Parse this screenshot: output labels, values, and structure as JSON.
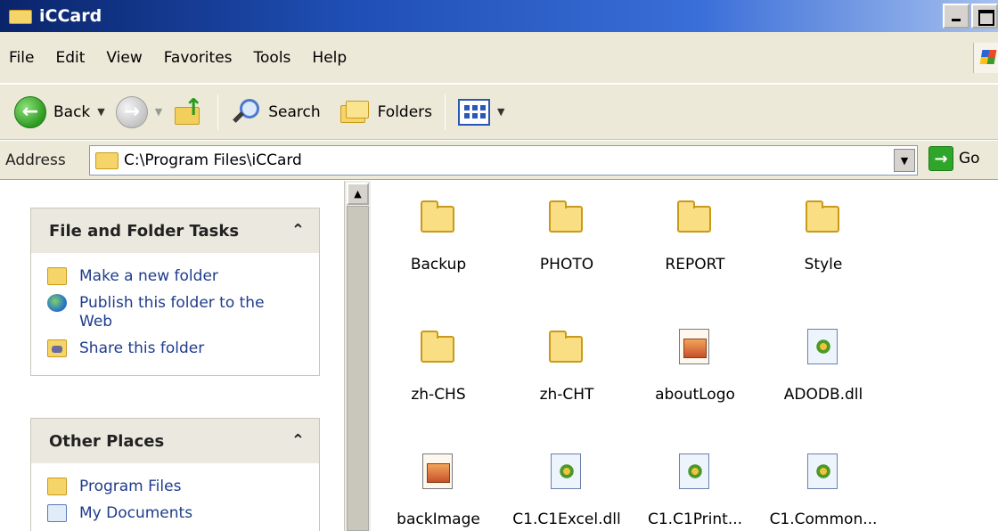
{
  "window": {
    "title": "iCCard",
    "title_icon": "folder-icon"
  },
  "menubar": {
    "items": [
      "File",
      "Edit",
      "View",
      "Favorites",
      "Tools",
      "Help"
    ]
  },
  "toolbar": {
    "back_label": "Back",
    "search_label": "Search",
    "folders_label": "Folders"
  },
  "address": {
    "label": "Address",
    "value": "C:\\Program Files\\iCCard",
    "go_label": "Go"
  },
  "taskpane": {
    "file_tasks": {
      "title": "File and Folder Tasks",
      "items": [
        "Make a new folder",
        "Publish this folder to the Web",
        "Share this folder"
      ]
    },
    "other_places": {
      "title": "Other Places",
      "items": [
        "Program Files",
        "My Documents"
      ]
    }
  },
  "files": [
    {
      "name": "Backup",
      "type": "folder"
    },
    {
      "name": "PHOTO",
      "type": "folder"
    },
    {
      "name": "REPORT",
      "type": "folder"
    },
    {
      "name": "Style",
      "type": "folder"
    },
    {
      "name": "zh-CHS",
      "type": "folder"
    },
    {
      "name": "zh-CHT",
      "type": "folder"
    },
    {
      "name": "aboutLogo",
      "type": "image"
    },
    {
      "name": "ADODB.dll",
      "type": "dll"
    },
    {
      "name": "backImage",
      "type": "image"
    },
    {
      "name": "C1.C1Excel.dll",
      "type": "dll"
    },
    {
      "name": "C1.C1Print...",
      "type": "dll"
    },
    {
      "name": "C1.Common...",
      "type": "dll"
    }
  ]
}
